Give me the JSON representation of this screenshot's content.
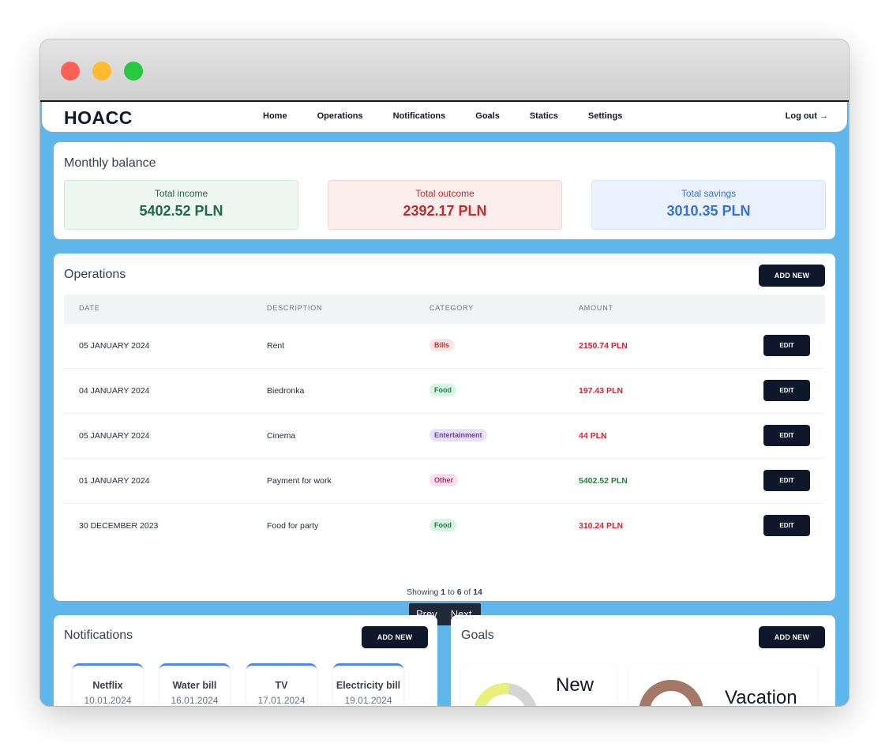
{
  "app": {
    "name": "HOACC"
  },
  "nav": {
    "items": [
      "Home",
      "Operations",
      "Notifications",
      "Goals",
      "Statics",
      "Settings"
    ],
    "logout": "Log out →"
  },
  "balance": {
    "title": "Monthly balance",
    "income": {
      "label": "Total income",
      "value": "5402.52 PLN",
      "color": "#1e6b46",
      "bg": "#eef7f1"
    },
    "outcome": {
      "label": "Total outcome",
      "value": "2392.17 PLN",
      "color": "#c42b2b",
      "bg": "#fdeeee"
    },
    "savings": {
      "label": "Total savings",
      "value": "3010.35 PLN",
      "color": "#3a6fe0",
      "bg": "#e9f2fe"
    }
  },
  "operations": {
    "title": "Operations",
    "add_label": "ADD NEW",
    "columns": [
      "DATE",
      "DESCRIPTION",
      "CATEGORY",
      "AMOUNT"
    ],
    "edit_label": "EDIT",
    "rows": [
      {
        "date": "05 JANUARY 2024",
        "description": "Rent",
        "category": "Bills",
        "amount": "2150.74 PLN",
        "kind": "out"
      },
      {
        "date": "04 JANUARY 2024",
        "description": "Biedronka",
        "category": "Food",
        "amount": "197.43 PLN",
        "kind": "out"
      },
      {
        "date": "05 JANUARY 2024",
        "description": "Cinema",
        "category": "Entertainment",
        "amount": "44 PLN",
        "kind": "out"
      },
      {
        "date": "01 JANUARY 2024",
        "description": "Payment for work",
        "category": "Other",
        "amount": "5402.52 PLN",
        "kind": "in"
      },
      {
        "date": "30 DECEMBER 2023",
        "description": "Food for party",
        "category": "Food",
        "amount": "310.24 PLN",
        "kind": "out"
      }
    ],
    "showing": {
      "prefix": "Showing",
      "from": "1",
      "to_word": "to",
      "to": "6",
      "of_word": "of",
      "total": "14"
    },
    "prev_label": "Prev",
    "next_label": "Next"
  },
  "category_colors": {
    "Bills": {
      "bg": "#fde2e2",
      "fg": "#c0392b"
    },
    "Food": {
      "bg": "#d7f5e3",
      "fg": "#1f7a4a"
    },
    "Entertainment": {
      "bg": "#e9e0fb",
      "fg": "#6d3fc4"
    },
    "Other": {
      "bg": "#fde0ec",
      "fg": "#b0306a"
    }
  },
  "amount_colors": {
    "out": "#e11d2e",
    "in": "#178a2e"
  },
  "notifications": {
    "title": "Notifications",
    "add_label": "ADD NEW",
    "items": [
      {
        "title": "Netflix",
        "date": "10.01.2024"
      },
      {
        "title": "Water bill",
        "date": "16.01.2024"
      },
      {
        "title": "TV",
        "date": "17.01.2024"
      },
      {
        "title": "Electricity bill",
        "date": "19.01.2024"
      }
    ]
  },
  "goals": {
    "title": "Goals",
    "add_label": "ADD NEW",
    "items": [
      {
        "title": "New",
        "ring_color": "#e9f07a"
      },
      {
        "title": "Vacation",
        "ring_color": "#a47766"
      }
    ]
  }
}
